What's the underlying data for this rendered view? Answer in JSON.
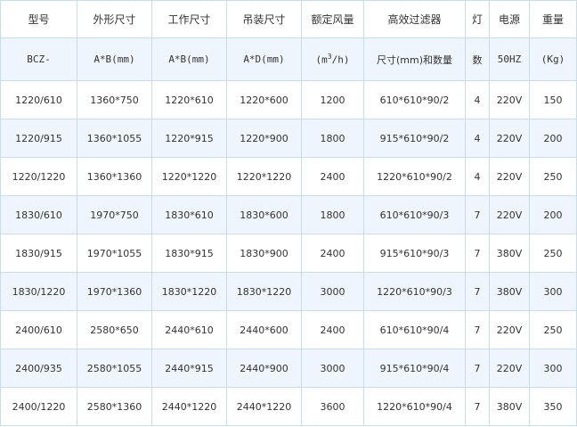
{
  "table": {
    "header": [
      "型号",
      "外形尺寸",
      "工作尺寸",
      "吊装尺寸",
      "额定风量",
      "高效过滤器",
      "灯",
      "电源",
      "重量"
    ],
    "subheader": {
      "model": "BCZ-",
      "outer": "A*B(mm)",
      "work": "A*B(mm)",
      "hang": "A*D(mm)",
      "air_prefix": "(m",
      "air_sup": "3",
      "air_suffix": "/h)",
      "filter": "尺寸(mm)和数量",
      "lamp": "数",
      "power": "50HZ",
      "weight": "(Kg)"
    },
    "rows": [
      [
        "1220/610",
        "1360*750",
        "1220*610",
        "1220*600",
        "1200",
        "610*610*90/2",
        "4",
        "220V",
        "150"
      ],
      [
        "1220/915",
        "1360*1055",
        "1220*915",
        "1220*900",
        "1800",
        "915*610*90/2",
        "4",
        "220V",
        "200"
      ],
      [
        "1220/1220",
        "1360*1360",
        "1220*1220",
        "1220*1220",
        "2400",
        "1220*610*90/2",
        "4",
        "220V",
        "250"
      ],
      [
        "1830/610",
        "1970*750",
        "1830*610",
        "1830*600",
        "1800",
        "610*610*90/3",
        "7",
        "220V",
        "200"
      ],
      [
        "1830/915",
        "1970*1055",
        "1830*915",
        "1830*900",
        "2400",
        "915*610*90/3",
        "7",
        "380V",
        "250"
      ],
      [
        "1830/1220",
        "1970*1360",
        "1830*1220",
        "1830*1220",
        "3000",
        "1220*610*90/3",
        "7",
        "380V",
        "300"
      ],
      [
        "2400/610",
        "2580*650",
        "2440*610",
        "2440*600",
        "2400",
        "610*610*90/4",
        "7",
        "220V",
        "250"
      ],
      [
        "2400/935",
        "2580*1055",
        "2440*915",
        "2440*900",
        "3000",
        "915*610*90/4",
        "7",
        "220V",
        "300"
      ],
      [
        "2400/1220",
        "2580*1360",
        "2440*1220",
        "2440*1220",
        "3600",
        "1220*610*90/4",
        "7",
        "380V",
        "350"
      ]
    ]
  },
  "colors": {
    "border": "#c6dcef",
    "stripe": "#eef5fc",
    "text": "#333333"
  }
}
